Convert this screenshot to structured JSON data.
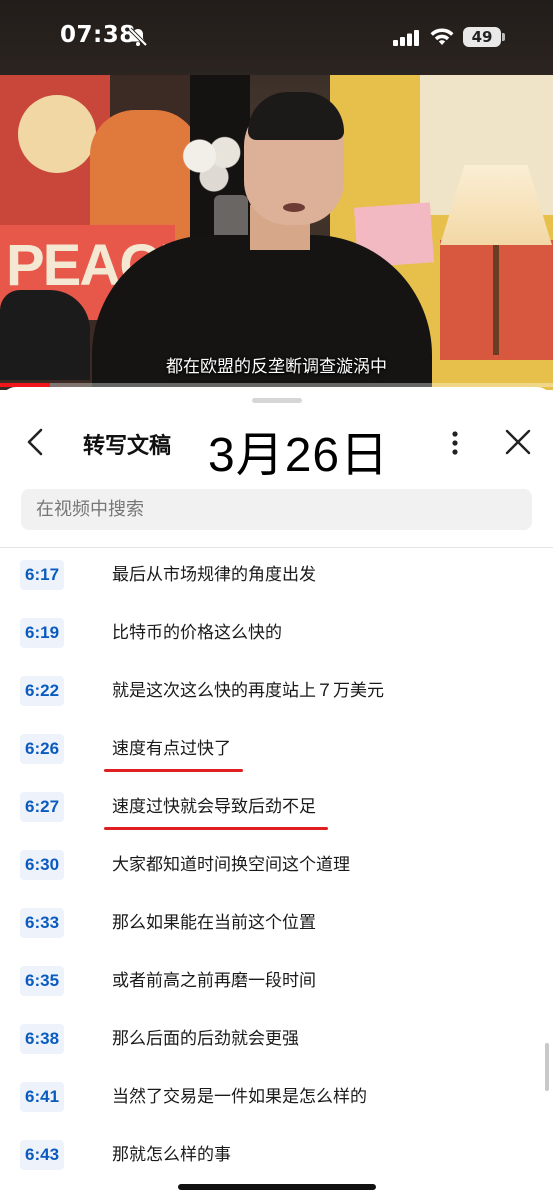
{
  "status_bar": {
    "time": "07:38",
    "battery": "49",
    "icons": [
      "bell-slash-icon",
      "cellular-signal-icon",
      "wifi-icon",
      "battery-icon"
    ]
  },
  "video": {
    "scene_text": "PEACE",
    "subtitle": "都在欧盟的反垄断调查漩涡中",
    "progress_fraction": 0.09,
    "progress_color": "#f2151c"
  },
  "panel": {
    "title": "转写文稿",
    "date_overlay": "3月26日",
    "search_placeholder": "在视频中搜索",
    "search_value": "",
    "icons": [
      "back-chevron-icon",
      "more-vertical-icon",
      "close-icon"
    ]
  },
  "transcript": [
    {
      "time": "6:17",
      "text": "最后从市场规律的角度出发",
      "underlined": false
    },
    {
      "time": "6:19",
      "text": "比特币的价格这么快的",
      "underlined": false
    },
    {
      "time": "6:22",
      "text": "就是这次这么快的再度站上７万美元",
      "underlined": false
    },
    {
      "time": "6:26",
      "text": "速度有点过快了",
      "underlined": true
    },
    {
      "time": "6:27",
      "text": "速度过快就会导致后劲不足",
      "underlined": true
    },
    {
      "time": "6:30",
      "text": "大家都知道时间换空间这个道理",
      "underlined": false
    },
    {
      "time": "6:33",
      "text": "那么如果能在当前这个位置",
      "underlined": false
    },
    {
      "time": "6:35",
      "text": "或者前高之前再磨一段时间",
      "underlined": false
    },
    {
      "time": "6:38",
      "text": "那么后面的后劲就会更强",
      "underlined": false
    },
    {
      "time": "6:41",
      "text": "当然了交易是一件如果是怎么样的",
      "underlined": false
    },
    {
      "time": "6:43",
      "text": "那就怎么样的事",
      "underlined": false
    }
  ],
  "colors": {
    "timestamp_text": "#0b5bbf",
    "timestamp_bg": "#eef3fb",
    "annotation_underline": "#e02020"
  }
}
